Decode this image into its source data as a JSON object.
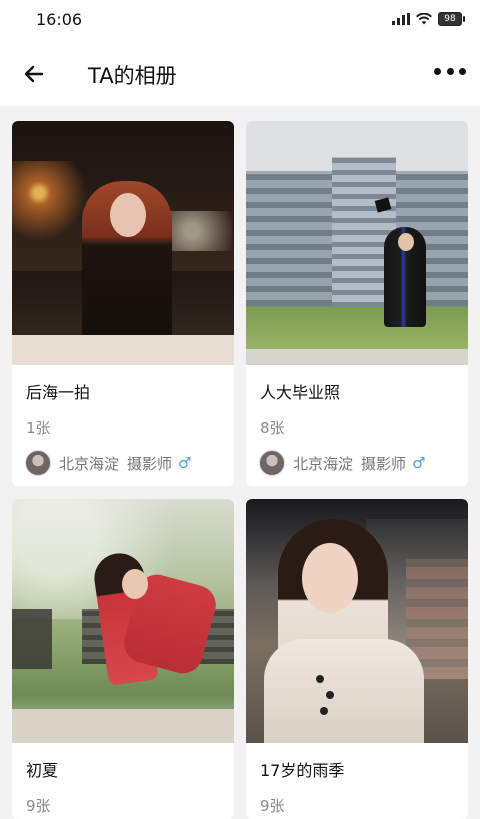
{
  "status_bar": {
    "time": "16:06",
    "battery": "98"
  },
  "header": {
    "title": "TA的相册"
  },
  "albums": [
    {
      "title": "后海一拍",
      "count": "1张",
      "user": {
        "location": "北京海淀",
        "role": "摄影师",
        "gender_symbol": "♂"
      }
    },
    {
      "title": "人大毕业照",
      "count": "8张",
      "user": {
        "location": "北京海淀",
        "role": "摄影师",
        "gender_symbol": "♂"
      }
    },
    {
      "title": "初夏",
      "count": "9张"
    },
    {
      "title": "17岁的雨季",
      "count": "9张"
    }
  ],
  "colors": {
    "accent_gender": "#4aa3d8"
  },
  "icons": [
    "back-arrow-icon",
    "more-dots-icon",
    "signal-icon",
    "wifi-icon",
    "battery-icon",
    "avatar"
  ]
}
